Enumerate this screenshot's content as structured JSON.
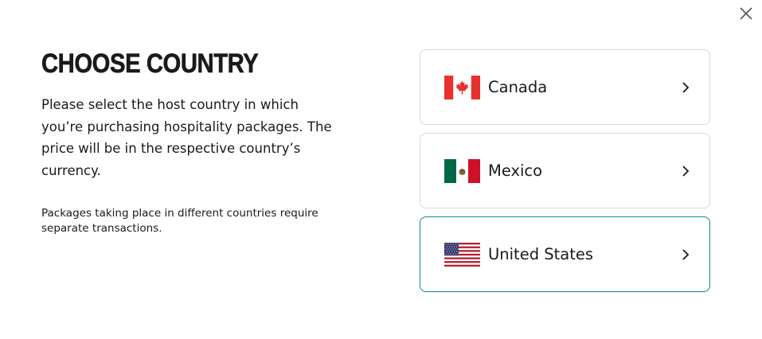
{
  "dialog": {
    "title": "CHOOSE COUNTRY",
    "description": "Please select the host country in which you’re purchasing hospitality packages. The price will be in the respective country’s currency.",
    "note": "Packages taking place in different countries require separate transactions.",
    "close_icon": "close-icon"
  },
  "countries": [
    {
      "name": "Canada",
      "flag_icon": "canada-flag-icon",
      "selected": false
    },
    {
      "name": "Mexico",
      "flag_icon": "mexico-flag-icon",
      "selected": false
    },
    {
      "name": "United States",
      "flag_icon": "usa-flag-icon",
      "selected": true
    }
  ],
  "colors": {
    "text": "#1a1a1a",
    "border": "#d9d9d9",
    "selected_border": "#0a8a8c",
    "canada_red": "#e8312f",
    "mexico_green": "#006847",
    "mexico_red": "#ce1126",
    "usa_red": "#b22234",
    "usa_blue": "#3c3b6e"
  }
}
